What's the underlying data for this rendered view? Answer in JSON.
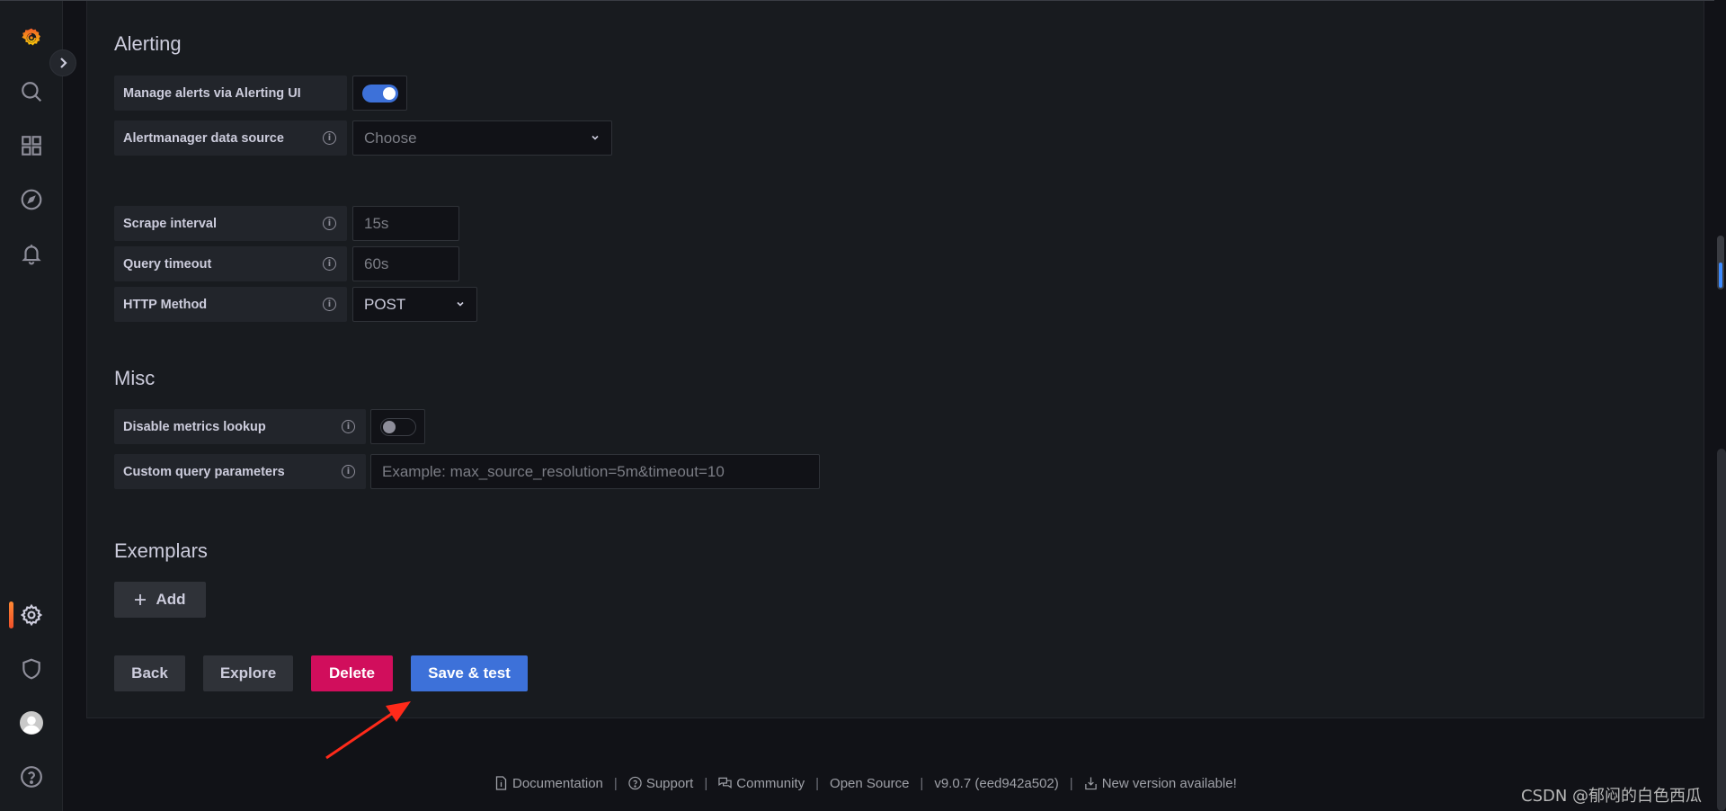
{
  "sidebar": {
    "items": [
      {
        "name": "grafana-logo",
        "label": "Home"
      },
      {
        "name": "search",
        "label": "Search"
      },
      {
        "name": "dashboards",
        "label": "Dashboards"
      },
      {
        "name": "explore",
        "label": "Explore"
      },
      {
        "name": "alerting",
        "label": "Alerting"
      },
      {
        "name": "configuration",
        "label": "Configuration",
        "active": true
      },
      {
        "name": "server-admin",
        "label": "Server Admin"
      },
      {
        "name": "profile",
        "label": "Profile"
      },
      {
        "name": "help",
        "label": "Help"
      }
    ],
    "accent_color": "#ff8833"
  },
  "alerting": {
    "title": "Alerting",
    "manage_alerts_label": "Manage alerts via Alerting UI",
    "manage_alerts_enabled": true,
    "alertmanager_label": "Alertmanager data source",
    "alertmanager_placeholder": "Choose"
  },
  "http_settings": {
    "scrape_interval_label": "Scrape interval",
    "scrape_interval_placeholder": "15s",
    "query_timeout_label": "Query timeout",
    "query_timeout_placeholder": "60s",
    "http_method_label": "HTTP Method",
    "http_method_value": "POST"
  },
  "misc": {
    "title": "Misc",
    "disable_metrics_label": "Disable metrics lookup",
    "disable_metrics_enabled": false,
    "custom_query_label": "Custom query parameters",
    "custom_query_placeholder": "Example: max_source_resolution=5m&timeout=10"
  },
  "exemplars": {
    "title": "Exemplars",
    "add_label": "Add"
  },
  "actions": {
    "back": "Back",
    "explore": "Explore",
    "delete": "Delete",
    "save_test": "Save & test",
    "delete_color": "#d10e5c",
    "primary_color": "#3d71d9"
  },
  "footer": {
    "documentation": "Documentation",
    "support": "Support",
    "community": "Community",
    "open_source": "Open Source",
    "version": "v9.0.7 (eed942a502)",
    "new_version": "New version available!",
    "separator": "|"
  },
  "watermark": "CSDN @郁闷的白色西瓜"
}
